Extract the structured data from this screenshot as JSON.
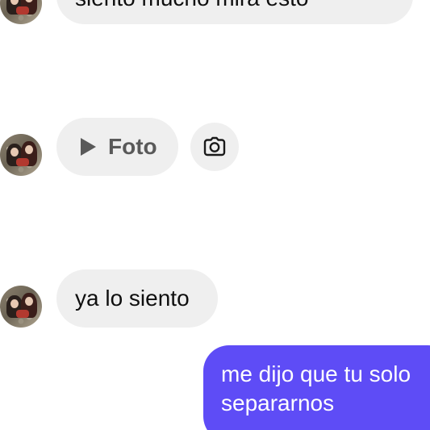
{
  "messages": [
    {
      "id": "top",
      "sender": "contact",
      "text": "siento mucho mira esto"
    },
    {
      "id": "foto",
      "sender": "contact",
      "type": "photo",
      "label": "Foto",
      "icon": "play-icon",
      "action_icon": "camera-icon"
    },
    {
      "id": "siento",
      "sender": "contact",
      "text": "ya lo siento"
    },
    {
      "id": "mine",
      "sender": "me",
      "lines": [
        "me dijo que tu solo",
        "separarnos"
      ]
    }
  ],
  "colors": {
    "incoming_bubble": "#efefef",
    "outgoing_bubble": "#5e4cf6",
    "incoming_text": "#0f0f0f",
    "outgoing_text": "#ffffff",
    "muted_text": "#595959"
  }
}
